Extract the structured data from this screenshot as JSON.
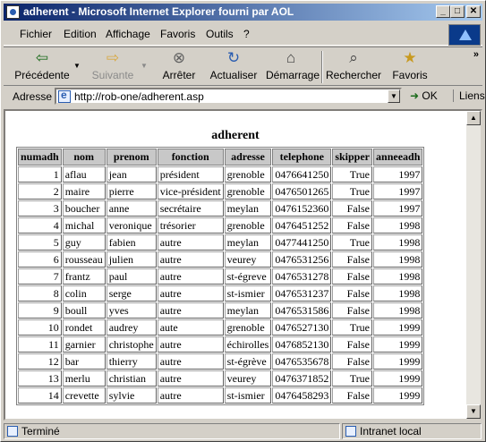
{
  "window": {
    "title": "adherent - Microsoft Internet Explorer fourni par AOL",
    "minimize": "_",
    "maximize": "□",
    "close": "✕"
  },
  "menu": {
    "items": [
      "Fichier",
      "Edition",
      "Affichage",
      "Favoris",
      "Outils",
      "?"
    ]
  },
  "toolbar": {
    "back": "Précédente",
    "forward": "Suivante",
    "stop": "Arrêter",
    "refresh": "Actualiser",
    "home": "Démarrage",
    "search": "Rechercher",
    "favorites": "Favoris",
    "more": "»"
  },
  "address": {
    "label": "Adresse",
    "url": "http://rob-one/adherent.asp",
    "go": "OK",
    "links": "Liens"
  },
  "page": {
    "heading": "adherent",
    "columns": [
      "numadh",
      "nom",
      "prenom",
      "fonction",
      "adresse",
      "telephone",
      "skipper",
      "anneeadh"
    ],
    "rows": [
      [
        "1",
        "aflau",
        "jean",
        "président",
        "grenoble",
        "0476641250",
        "True",
        "1997"
      ],
      [
        "2",
        "maire",
        "pierre",
        "vice-président",
        "grenoble",
        "0476501265",
        "True",
        "1997"
      ],
      [
        "3",
        "boucher",
        "anne",
        "secrétaire",
        "meylan",
        "0476152360",
        "False",
        "1997"
      ],
      [
        "4",
        "michal",
        "veronique",
        "trésorier",
        "grenoble",
        "0476451252",
        "False",
        "1998"
      ],
      [
        "5",
        "guy",
        "fabien",
        "autre",
        "meylan",
        "0477441250",
        "True",
        "1998"
      ],
      [
        "6",
        "rousseau",
        "julien",
        "autre",
        "veurey",
        "0476531256",
        "False",
        "1998"
      ],
      [
        "7",
        "frantz",
        "paul",
        "autre",
        "st-égreve",
        "0476531278",
        "False",
        "1998"
      ],
      [
        "8",
        "colin",
        "serge",
        "autre",
        "st-ismier",
        "0476531237",
        "False",
        "1998"
      ],
      [
        "9",
        "boull",
        "yves",
        "autre",
        "meylan",
        "0476531586",
        "False",
        "1998"
      ],
      [
        "10",
        "rondet",
        "audrey",
        "aute",
        "grenoble",
        "0476527130",
        "True",
        "1999"
      ],
      [
        "11",
        "garnier",
        "christophe",
        "autre",
        "échirolles",
        "0476852130",
        "False",
        "1999"
      ],
      [
        "12",
        "bar",
        "thierry",
        "autre",
        "st-égrève",
        "0476535678",
        "False",
        "1999"
      ],
      [
        "13",
        "merlu",
        "christian",
        "autre",
        "veurey",
        "0476371852",
        "True",
        "1999"
      ],
      [
        "14",
        "crevette",
        "sylvie",
        "autre",
        "st-ismier",
        "0476458293",
        "False",
        "1999"
      ]
    ]
  },
  "status": {
    "text": "Terminé",
    "zone": "Intranet local"
  }
}
